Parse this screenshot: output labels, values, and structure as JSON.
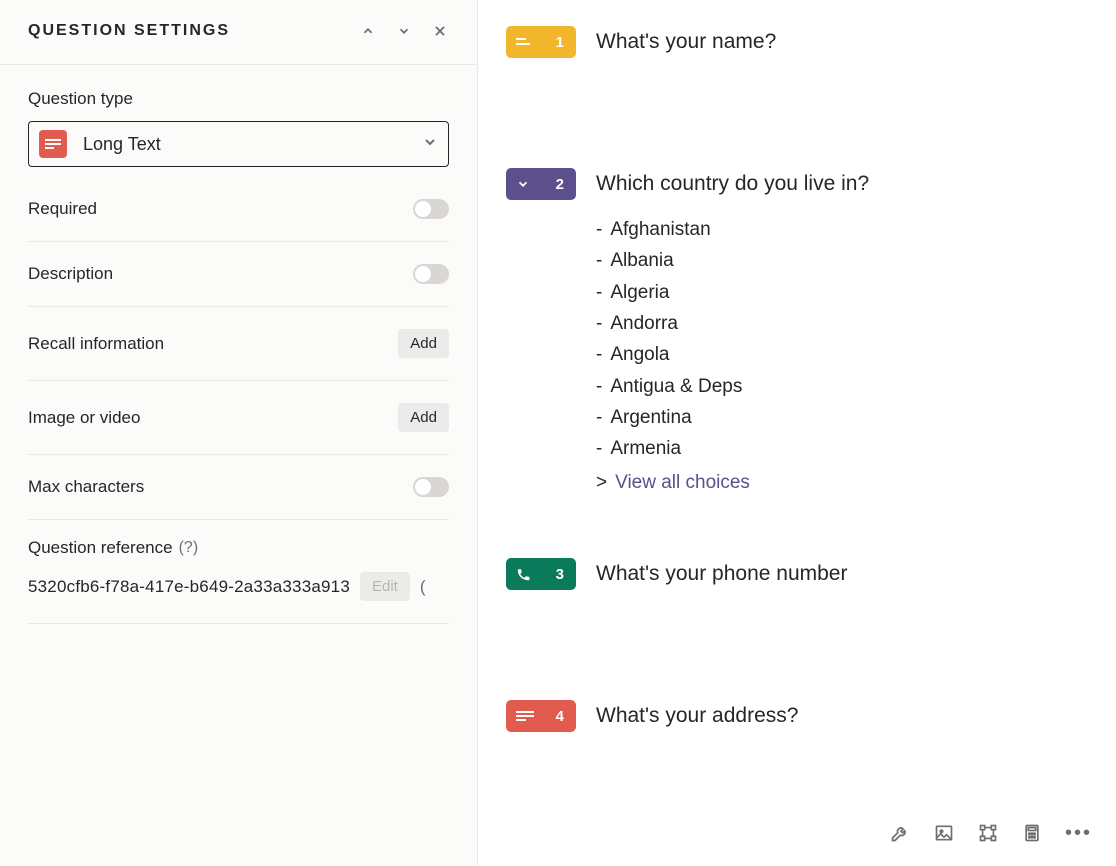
{
  "settings": {
    "title": "QUESTION SETTINGS",
    "question_type_label": "Question type",
    "question_type_value": "Long Text",
    "rows": {
      "required": {
        "label": "Required"
      },
      "description": {
        "label": "Description"
      },
      "recall": {
        "label": "Recall information",
        "button": "Add"
      },
      "media": {
        "label": "Image or video",
        "button": "Add"
      },
      "max_chars": {
        "label": "Max characters"
      }
    },
    "reference": {
      "label": "Question reference",
      "help": "(?)",
      "value": "5320cfb6-f78a-417e-b649-2a33a333a913",
      "edit_button": "Edit",
      "trailing": "("
    }
  },
  "questions": [
    {
      "num": "1",
      "color": "yellow",
      "icon": "short-text",
      "title": "What's your name?"
    },
    {
      "num": "2",
      "color": "purple",
      "icon": "dropdown",
      "title": "Which country do you live in?"
    },
    {
      "num": "3",
      "color": "green",
      "icon": "phone",
      "title": "What's your phone number"
    },
    {
      "num": "4",
      "color": "red",
      "icon": "long-text",
      "title": "What's your address?"
    }
  ],
  "choices": [
    "Afghanistan",
    "Albania",
    "Algeria",
    "Andorra",
    "Angola",
    "Antigua & Deps",
    "Argentina",
    "Armenia"
  ],
  "view_all": "View all choices"
}
